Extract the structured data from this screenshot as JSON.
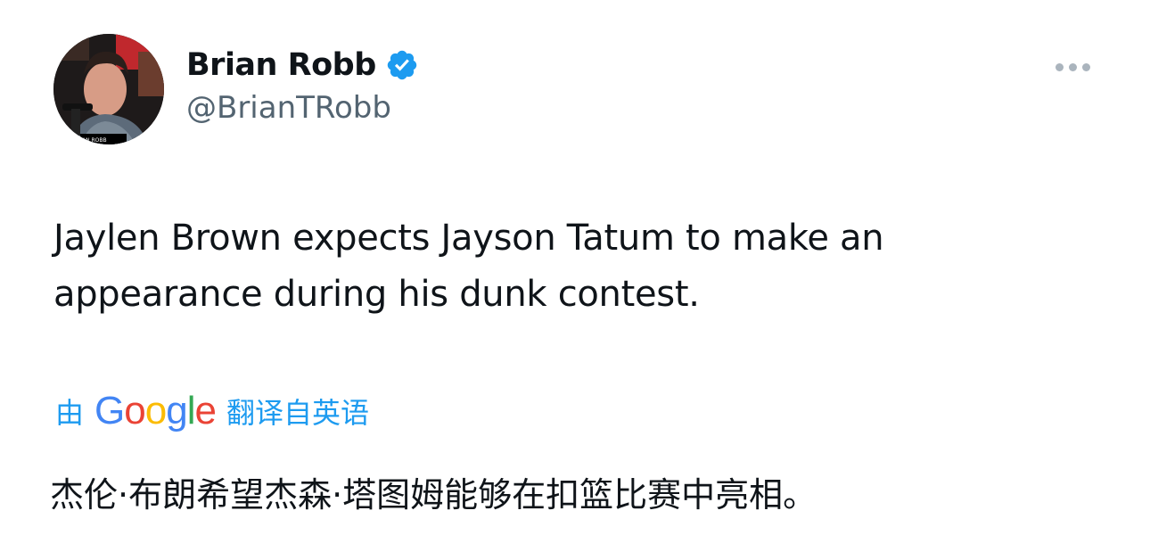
{
  "author": {
    "display_name": "Brian Robb",
    "handle": "@BrianTRobb",
    "verified": true,
    "avatar_caption": "AN ROBB"
  },
  "tweet": {
    "text": "Jaylen Brown expects Jayson Tatum to make an appearance during his dunk contest."
  },
  "translation": {
    "prefix": "由",
    "logo_letters": [
      "G",
      "o",
      "o",
      "g",
      "l",
      "e"
    ],
    "suffix": "翻译自英语",
    "translated_text": "杰伦·布朗希望杰森·塔图姆能够在扣篮比赛中亮相。"
  },
  "icons": {
    "verified": "verified-badge-icon",
    "more": "more-options-icon"
  },
  "colors": {
    "text_primary": "#0f1419",
    "text_secondary": "#536471",
    "accent": "#1d9bf0",
    "google_blue": "#4285f4",
    "google_red": "#ea4335",
    "google_yellow": "#fbbc05",
    "google_green": "#34a853"
  }
}
